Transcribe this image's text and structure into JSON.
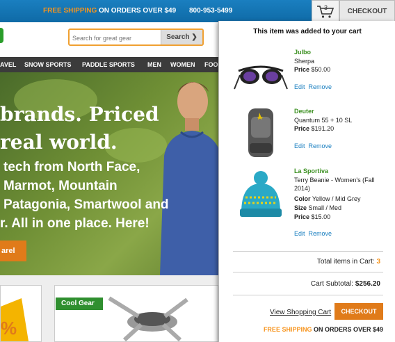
{
  "topbar": {
    "free_shipping": "FREE SHIPPING",
    "promo_rest": "ON ORDERS OVER $49",
    "phone": "800-953-5499",
    "cart_count": "3",
    "checkout_label": "CHECKOUT"
  },
  "search": {
    "placeholder": "Search for great gear",
    "button_label": "Search"
  },
  "nav": [
    "AVEL",
    "SNOW SPORTS",
    "PADDLE SPORTS",
    "MEN",
    "WOMEN",
    "FOO"
  ],
  "hero": {
    "line1": "brands. Priced",
    "line2": "real world.",
    "line3": "tech from North Face,",
    "line4": "Marmot, Mountain",
    "line5": "Patagonia, Smartwool and",
    "line6": "r. All in one place. Here!",
    "button": "arel"
  },
  "lower": {
    "cool_gear_tag": "Cool Gear"
  },
  "cart_dropdown": {
    "title": "This item was added to your cart",
    "items": [
      {
        "brand": "Julbo",
        "name": "Sherpa",
        "price_label": "Price",
        "price": "$50.00",
        "edit": "Edit",
        "remove": "Remove"
      },
      {
        "brand": "Deuter",
        "name": "Quantum 55 + 10 SL",
        "price_label": "Price",
        "price": "$191.20",
        "edit": "Edit",
        "remove": "Remove"
      },
      {
        "brand": "La Sportiva",
        "name": "Terry Beanie - Women's (Fall 2014)",
        "color_label": "Color",
        "color": "Yellow / Mid Grey",
        "size_label": "Size",
        "size": "Small / Med",
        "price_label": "Price",
        "price": "$15.00",
        "edit": "Edit",
        "remove": "Remove"
      }
    ],
    "total_items_label": "Total items in Cart:",
    "total_items": "3",
    "subtotal_label": "Cart Subtotal:",
    "subtotal": "$256.20",
    "view_cart": "View Shopping Cart",
    "checkout": "CHECKOUT",
    "free_shipping": "FREE SHIPPING",
    "shipping_rest": "ON ORDERS OVER $49"
  },
  "colors": {
    "topbar": "#1a7fc0",
    "accent_orange": "#e07b1a",
    "brand_green": "#3a8f1f",
    "link_blue": "#1a7fc0"
  },
  "icons": {
    "cart": "cart-icon",
    "search_chevron": "chevron-right-icon"
  }
}
